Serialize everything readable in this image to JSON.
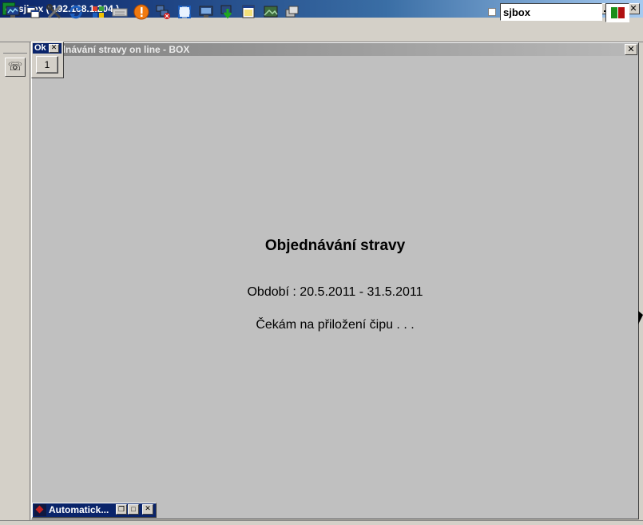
{
  "window": {
    "title": "sjbox ( 192.168.1.204 )"
  },
  "toolbar": {
    "icons": [
      "monitor-icon",
      "windows-icon",
      "tools-icon",
      "refresh-icon",
      "windows-logo-icon",
      "keyboard-icon",
      "warning-icon",
      "network-close-icon",
      "fullscreen-icon",
      "display-icon",
      "download-icon",
      "paint-icon",
      "picture-icon",
      "windows-stack-icon"
    ],
    "host_field": "sjbox",
    "colors": {
      "green": "#1a8f1a",
      "red": "#b01010"
    }
  },
  "popup": {
    "title": "Ok",
    "button_label": "1"
  },
  "child_window": {
    "title": "ednávání stravy on line - BOX"
  },
  "main": {
    "heading": "Objednávání stravy",
    "period": "Období : 20.5.2011 - 31.5.2011",
    "status": "Čekám na přiložení čipu  . . ."
  },
  "taskbar": {
    "item_label": "Automatick..."
  }
}
